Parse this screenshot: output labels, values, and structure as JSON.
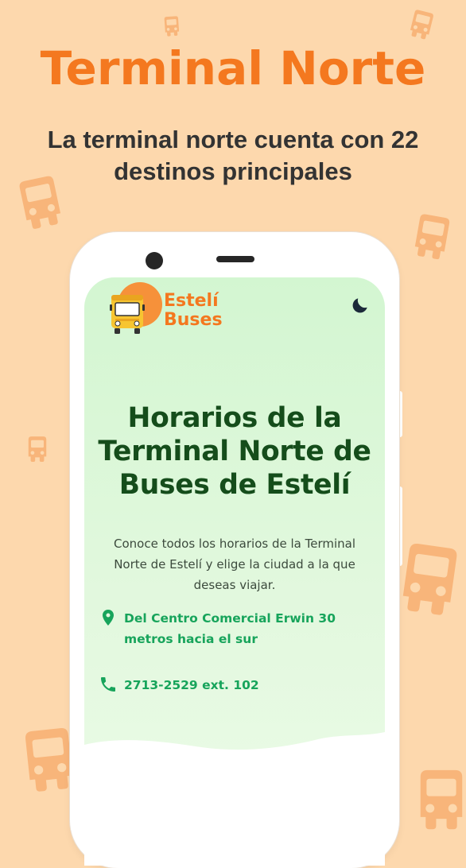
{
  "promo": {
    "title": "Terminal Norte",
    "subtitle": "La terminal norte cuenta con 22 destinos principales"
  },
  "app": {
    "logo": {
      "line1": "Estelí",
      "line2": "Buses",
      "icon": "bus-icon",
      "sun_color": "#f6913a"
    },
    "theme_toggle_icon": "moon-icon",
    "hero": {
      "title": "Horarios de la Terminal Norte de Buses de Estelí",
      "description": "Conoce todos los horarios de la Terminal Norte de Estelí y elige la ciudad a la que deseas viajar."
    },
    "address": {
      "icon": "location-pin-icon",
      "text": "Del Centro Comercial Erwin 30 metros hacia el sur"
    },
    "phone": {
      "icon": "phone-icon",
      "text": "2713-2529 ext. 102"
    }
  },
  "colors": {
    "background": "#fdd8ad",
    "accent_orange": "#f4781f",
    "headline_green": "#154d1b",
    "link_green": "#17a45b",
    "background_bus": "#f8b57a"
  }
}
